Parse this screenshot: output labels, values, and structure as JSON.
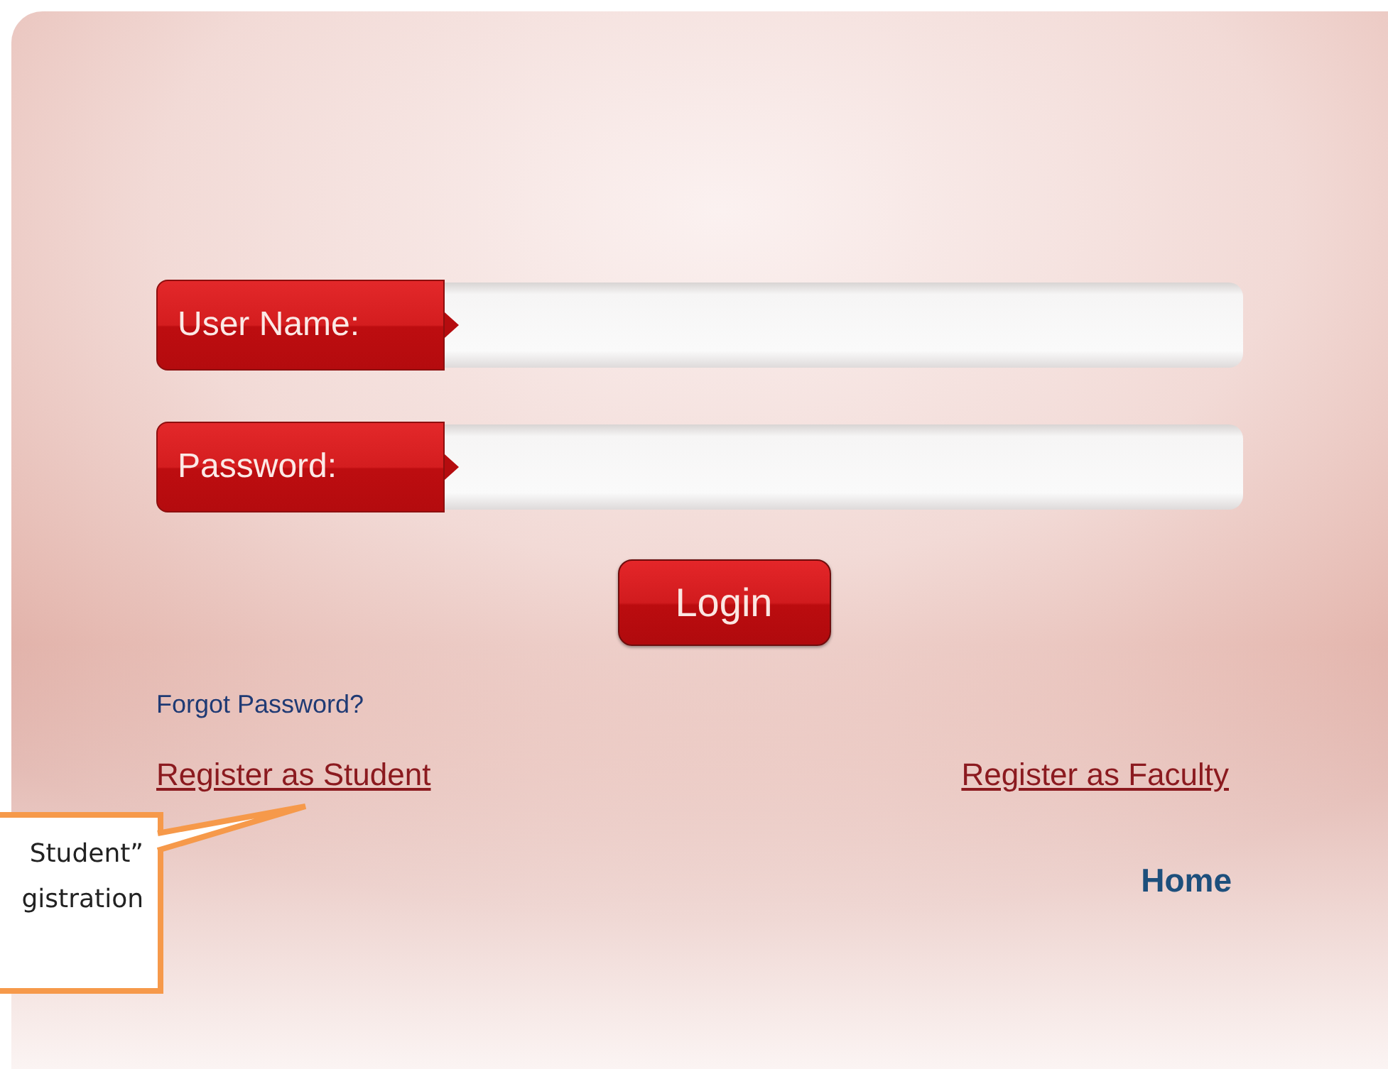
{
  "fields": [
    {
      "label": "User Name:"
    },
    {
      "label": "Password:"
    }
  ],
  "login_button": "Login",
  "forgot_link": "Forgot Password?",
  "register_links": [
    "Register as Student",
    "Register as Faculty"
  ],
  "home_link": "Home",
  "callout": {
    "lines": [
      "Student”",
      "gistration"
    ]
  }
}
